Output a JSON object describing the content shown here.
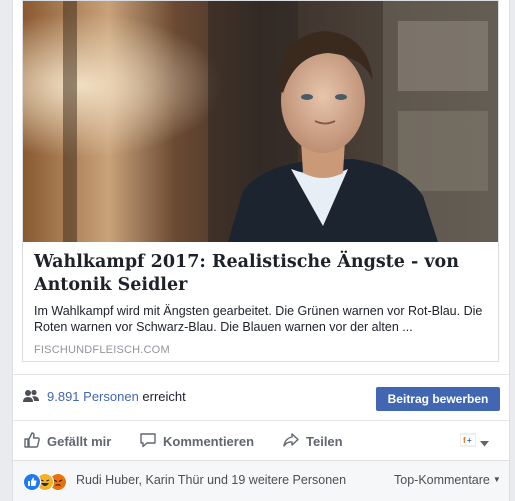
{
  "card": {
    "title": "Wahlkampf 2017: Realistische Ängste - von Antonik Seidler",
    "description": "Im Wahlkampf wird mit Ängsten gearbeitet. Die Grünen warnen vor Rot-Blau. Die Roten warnen vor Schwarz-Blau. Die Blauen warnen vor der alten ...",
    "domain": "FISCHUNDFLEISCH.COM"
  },
  "reach": {
    "icon": "people-icon",
    "count": "9.891 Personen",
    "suffix": "erreicht",
    "boost_label": "Beitrag bewerben"
  },
  "actions": {
    "like": "Gefällt mir",
    "comment": "Kommentieren",
    "share": "Teilen"
  },
  "reactions": {
    "icons": [
      "like-reaction-icon",
      "haha-reaction-icon",
      "angry-reaction-icon"
    ],
    "names": "Rudi Huber, Karin Thür und 19 weitere Personen",
    "sort_label": "Top-Kommentare"
  },
  "colors": {
    "accent": "#4267b2",
    "like": "#2078f4",
    "haha": "#f7b125",
    "angry": "#e9710f"
  }
}
